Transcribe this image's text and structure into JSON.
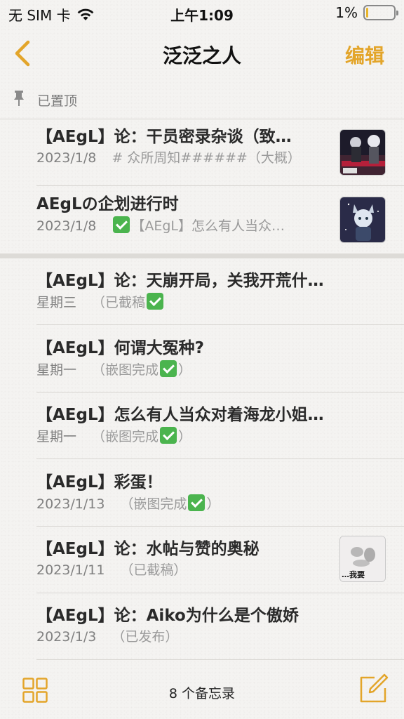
{
  "status_bar": {
    "carrier": "无 SIM 卡",
    "time": "上午1:09",
    "battery_percent": "1%",
    "battery_level": 0.01
  },
  "nav": {
    "back_icon": "chevron-left-icon",
    "title": "泛泛之人",
    "edit_label": "编辑"
  },
  "pinned": {
    "label": "已置顶",
    "notes": [
      {
        "title": "【AEgL】论：干员密录杂谈（致…",
        "date": "2023/1/8",
        "snippet": "# 众所周知######（大概）",
        "has_check": false,
        "thumb": "dark-anime-scene"
      },
      {
        "title": "AEgLの企划进行时",
        "date": "2023/1/8",
        "snippet": "【AEgL】怎么有人当众…",
        "has_check": true,
        "thumb": "chibi-character-space"
      }
    ]
  },
  "notes": [
    {
      "title": "【AEgL】论：天崩开局，关我开荒什…",
      "date": "星期三",
      "snippet": "（已截稿",
      "check_after": true,
      "snippet_end": ""
    },
    {
      "title": "【AEgL】何谓大冤种?",
      "date": "星期一",
      "snippet": "（嵌图完成",
      "check_after": true,
      "snippet_end": "）"
    },
    {
      "title": "【AEgL】怎么有人当众对着海龙小姐…",
      "date": "星期一",
      "snippet": "（嵌图完成",
      "check_after": true,
      "snippet_end": "）"
    },
    {
      "title": "【AEgL】彩蛋！",
      "date": "2023/1/13",
      "snippet": "（嵌图完成",
      "check_after": true,
      "snippet_end": "）"
    },
    {
      "title": "【AEgL】论：水帖与赞的奥秘",
      "date": "2023/1/11",
      "snippet": "（已截稿）",
      "check_after": false,
      "snippet_end": "",
      "thumb_text": "…我要"
    },
    {
      "title": "【AEgL】论：Aiko为什么是个傲娇",
      "date": "2023/1/3",
      "snippet": "（已发布）",
      "check_after": false,
      "snippet_end": ""
    }
  ],
  "toolbar": {
    "gallery_icon": "grid-view-icon",
    "count_label": "8 个备忘录",
    "compose_icon": "compose-icon"
  },
  "colors": {
    "accent": "#e3a52a",
    "background": "#f4f3f1",
    "check": "#4bb44e"
  }
}
